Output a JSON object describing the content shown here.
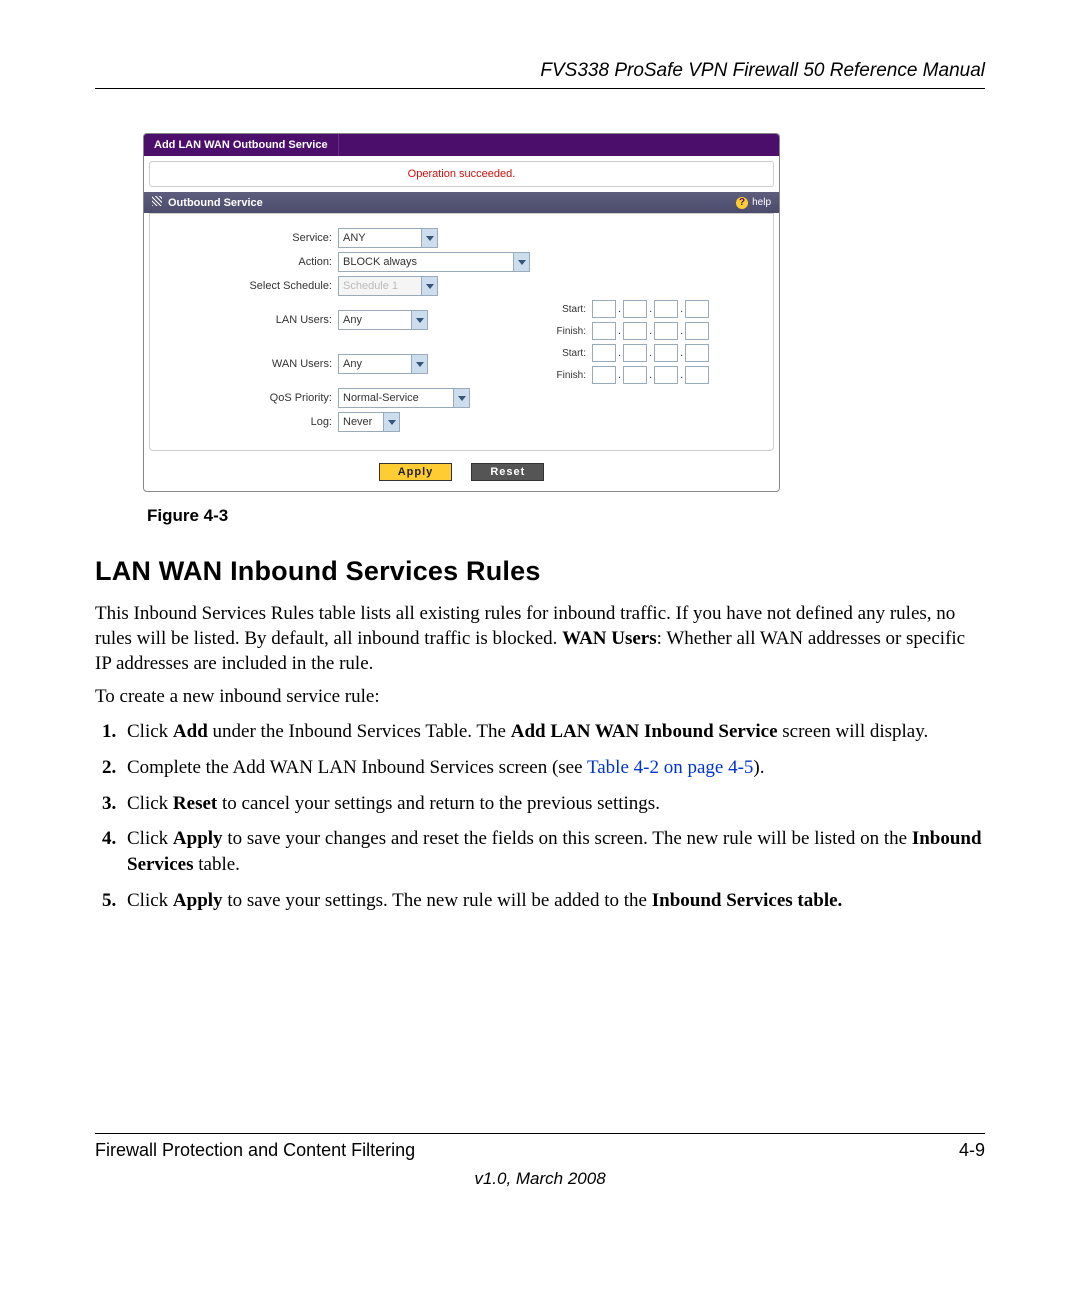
{
  "header": {
    "title": "FVS338 ProSafe VPN Firewall 50 Reference Manual"
  },
  "screenshot": {
    "tab": "Add LAN WAN Outbound Service",
    "status": "Operation succeeded.",
    "section_title": "Outbound Service",
    "help_label": "help",
    "fields": {
      "service": {
        "label": "Service:",
        "value": "ANY"
      },
      "action": {
        "label": "Action:",
        "value": "BLOCK always"
      },
      "schedule": {
        "label": "Select Schedule:",
        "value": "Schedule 1"
      },
      "lan_users": {
        "label": "LAN Users:",
        "value": "Any"
      },
      "wan_users": {
        "label": "WAN Users:",
        "value": "Any"
      },
      "qos": {
        "label": "QoS Priority:",
        "value": "Normal-Service"
      },
      "log": {
        "label": "Log:",
        "value": "Never"
      },
      "start": "Start:",
      "finish": "Finish:"
    },
    "buttons": {
      "apply": "Apply",
      "reset": "Reset"
    }
  },
  "figure_caption": "Figure 4-3",
  "section_heading": "LAN WAN Inbound Services Rules",
  "para1_a": "This Inbound Services Rules table lists all existing rules for inbound traffic. If you have not defined any rules, no rules will be listed. By default, all inbound traffic is blocked. ",
  "para1_b": "WAN Users",
  "para1_c": ": Whether all WAN addresses or specific IP addresses are included in the rule.",
  "para2": "To create a new inbound service rule:",
  "steps": {
    "s1a": "Click ",
    "s1b": "Add",
    "s1c": " under the Inbound Services Table. The ",
    "s1d": "Add LAN WAN Inbound Service",
    "s1e": " screen will display.",
    "s2a": "Complete the Add WAN LAN Inbound Services screen (see ",
    "s2link": "Table 4-2 on page 4-5",
    "s2b": ").",
    "s3a": "Click ",
    "s3b": "Reset",
    "s3c": " to cancel your settings and return to the previous settings.",
    "s4a": "Click ",
    "s4b": "Apply",
    "s4c": " to save your changes and reset the fields on this screen. The new rule will be listed on the ",
    "s4d": "Inbound Services",
    "s4e": " table.",
    "s5a": "Click ",
    "s5b": "Apply",
    "s5c": " to save your settings. The new rule will be added to the ",
    "s5d": "Inbound Services table."
  },
  "footer": {
    "left": "Firewall Protection and Content Filtering",
    "right": "4-9",
    "version": "v1.0, March 2008"
  }
}
